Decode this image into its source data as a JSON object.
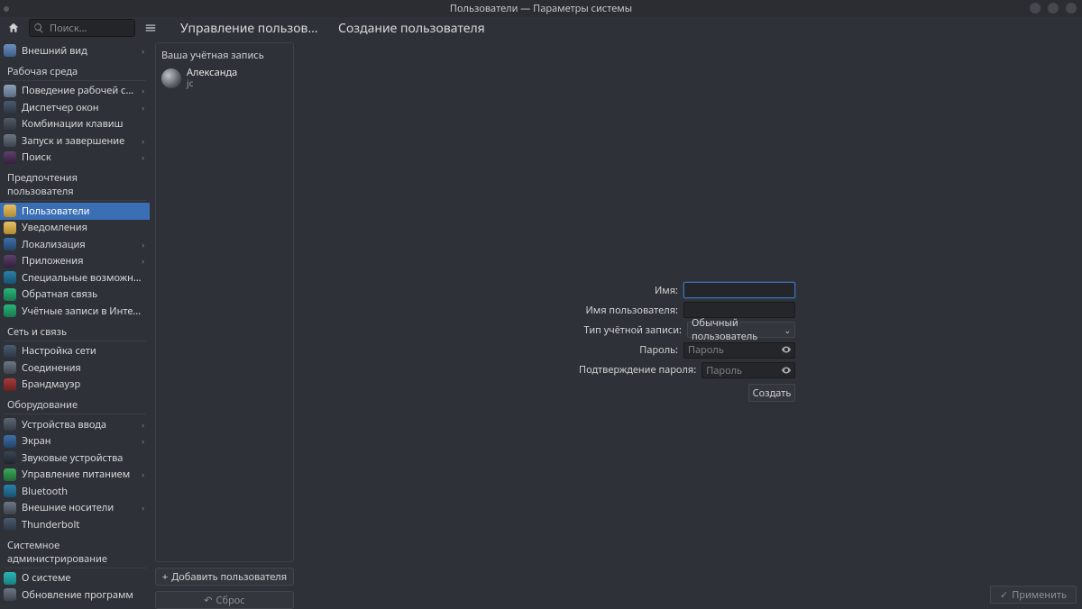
{
  "window": {
    "title": "Пользователи — Параметры системы"
  },
  "toolbar": {
    "search_placeholder": "Поиск…",
    "breadcrumb1": "Управление пользоват...",
    "breadcrumb2": "Создание пользователя"
  },
  "sidebar": {
    "top_item": {
      "label": "Внешний вид"
    },
    "sections": [
      {
        "title": "Рабочая среда",
        "items": [
          {
            "label": "Поведение рабочей среды",
            "chev": true,
            "ic": "c-be"
          },
          {
            "label": "Диспетчер окон",
            "chev": true,
            "ic": "c-wm"
          },
          {
            "label": "Комбинации клавиш",
            "chev": false,
            "ic": "c-kb"
          },
          {
            "label": "Запуск и завершение",
            "chev": true,
            "ic": "c-ss"
          },
          {
            "label": "Поиск",
            "chev": true,
            "ic": "c-sr"
          }
        ]
      },
      {
        "title": "Предпочтения пользователя",
        "items": [
          {
            "label": "Пользователи",
            "chev": false,
            "ic": "c-us",
            "selected": true
          },
          {
            "label": "Уведомления",
            "chev": false,
            "ic": "c-no"
          },
          {
            "label": "Локализация",
            "chev": true,
            "ic": "c-lo"
          },
          {
            "label": "Приложения",
            "chev": true,
            "ic": "c-ap"
          },
          {
            "label": "Специальные возможности",
            "chev": false,
            "ic": "c-ac"
          },
          {
            "label": "Обратная связь",
            "chev": false,
            "ic": "c-fb"
          },
          {
            "label": "Учётные записи в Интернете",
            "chev": false,
            "ic": "c-oa"
          }
        ]
      },
      {
        "title": "Сеть и связь",
        "items": [
          {
            "label": "Настройка сети",
            "chev": false,
            "ic": "c-nw"
          },
          {
            "label": "Соединения",
            "chev": false,
            "ic": "c-co"
          },
          {
            "label": "Брандмауэр",
            "chev": false,
            "ic": "c-fw"
          }
        ]
      },
      {
        "title": "Оборудование",
        "items": [
          {
            "label": "Устройства ввода",
            "chev": true,
            "ic": "c-in"
          },
          {
            "label": "Экран",
            "chev": true,
            "ic": "c-di"
          },
          {
            "label": "Звуковые устройства",
            "chev": false,
            "ic": "c-au"
          },
          {
            "label": "Управление питанием",
            "chev": true,
            "ic": "c-pm"
          },
          {
            "label": "Bluetooth",
            "chev": false,
            "ic": "c-bt"
          },
          {
            "label": "Внешние носители",
            "chev": true,
            "ic": "c-ex"
          },
          {
            "label": "Thunderbolt",
            "chev": false,
            "ic": "c-tb"
          }
        ]
      },
      {
        "title": "Системное администрирование",
        "items": [
          {
            "label": "О системе",
            "chev": false,
            "ic": "c-ab"
          },
          {
            "label": "Обновление программ",
            "chev": false,
            "ic": "c-up"
          }
        ]
      }
    ]
  },
  "userlist": {
    "header": "Ваша учётная запись",
    "user_name": "Александа",
    "user_login": "jc",
    "add_label": "Добавить пользователя",
    "reset_label": "Сброс"
  },
  "form": {
    "name_label": "Имя:",
    "username_label": "Имя пользователя:",
    "type_label": "Тип учётной записи:",
    "type_value": "Обычный пользователь",
    "password_label": "Пароль:",
    "confirm_label": "Подтверждение пароля:",
    "password_placeholder": "Пароль",
    "create_label": "Создать"
  },
  "footer": {
    "apply_label": "Применить"
  }
}
